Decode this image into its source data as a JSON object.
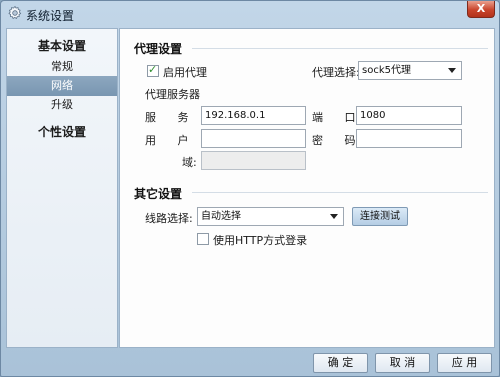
{
  "window": {
    "title": "系统设置",
    "close_glyph": "X"
  },
  "sidebar": {
    "groups": [
      {
        "label": "基本设置",
        "items": [
          {
            "label": "常规"
          },
          {
            "label": "网络"
          },
          {
            "label": "升级"
          }
        ]
      },
      {
        "label": "个性设置",
        "items": []
      }
    ],
    "selected": "网络"
  },
  "proxy": {
    "title": "代理设置",
    "enable_label": "启用代理",
    "enabled": true,
    "select_label": "代理选择:",
    "select_value": "sock5代理",
    "server_title": "代理服务器",
    "server_label": "服 务 器:",
    "server_value": "192.168.0.1",
    "port_label": "端 口:",
    "port_value": "1080",
    "user_label": "用 户 名:",
    "user_value": "",
    "password_label": "密 码:",
    "password_value": "",
    "domain_label": "域:",
    "domain_value": ""
  },
  "other": {
    "title": "其它设置",
    "route_label": "线路选择:",
    "route_value": "自动选择",
    "test_button": "连接测试",
    "http_label": "使用HTTP方式登录",
    "http_checked": false
  },
  "footer": {
    "ok": "确 定",
    "cancel": "取 消",
    "apply": "应 用"
  }
}
